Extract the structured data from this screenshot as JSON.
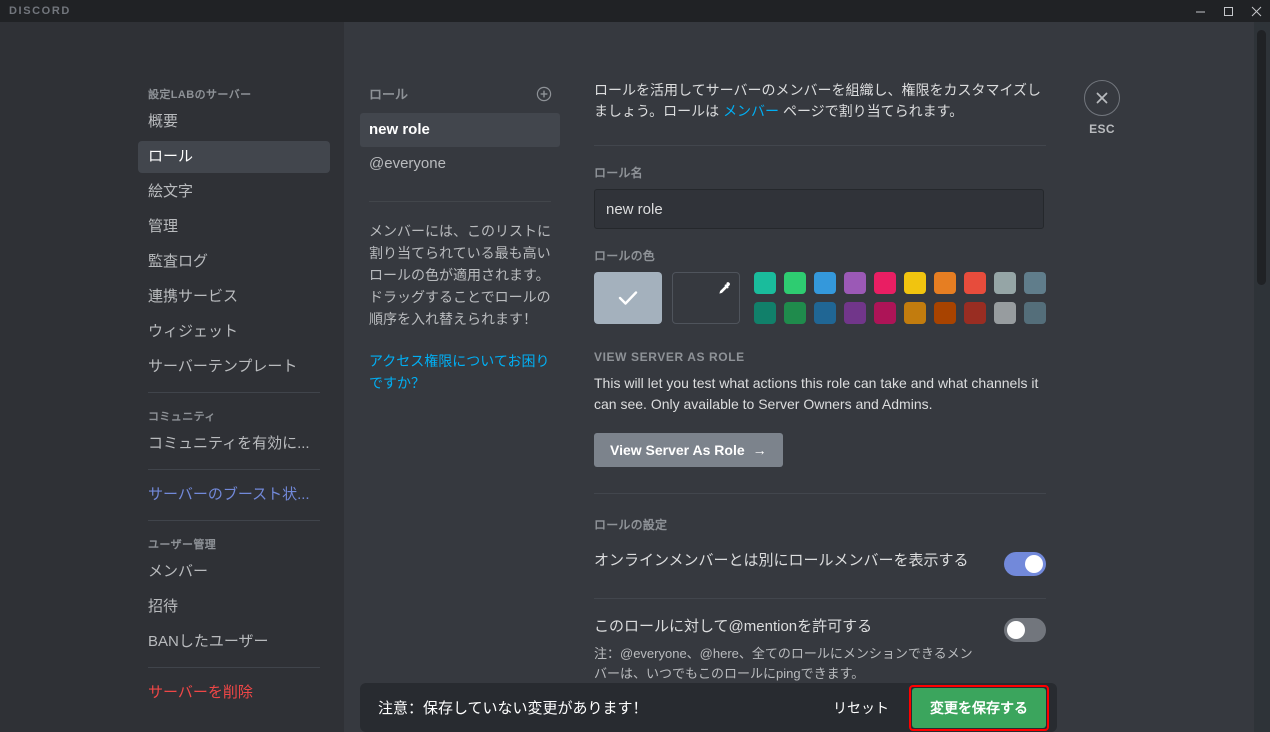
{
  "titlebar": {
    "brand": "DISCORD",
    "minimize_label": "minimize",
    "maximize_label": "maximize",
    "close_label": "close"
  },
  "sidebar": {
    "server_header": "設定LABのサーバー",
    "items": [
      {
        "label": "概要",
        "state": "normal"
      },
      {
        "label": "ロール",
        "state": "active"
      },
      {
        "label": "絵文字",
        "state": "normal"
      },
      {
        "label": "管理",
        "state": "normal"
      },
      {
        "label": "監査ログ",
        "state": "normal"
      },
      {
        "label": "連携サービス",
        "state": "normal"
      },
      {
        "label": "ウィジェット",
        "state": "normal"
      },
      {
        "label": "サーバーテンプレート",
        "state": "normal"
      }
    ],
    "community_header": "コミュニティ",
    "community_item": "コミュニティを有効に...",
    "boost_item": "サーバーのブースト状...",
    "user_header": "ユーザー管理",
    "user_items": [
      {
        "label": "メンバー"
      },
      {
        "label": "招待"
      },
      {
        "label": "BANしたユーザー"
      }
    ],
    "delete_item": "サーバーを削除"
  },
  "roles_panel": {
    "header": "ロール",
    "add_icon": "plus-circle-icon",
    "roles": [
      {
        "name": "new role",
        "selected": true
      },
      {
        "name": "@everyone",
        "selected": false
      }
    ],
    "note": "メンバーには、このリストに割り当てられている最も高いロールの色が適用されます。ドラッグすることでロールの順序を入れ替えられます！",
    "help_link": "アクセス権限についてお困りですか？"
  },
  "main": {
    "intro_before": "ロールを活用してサーバーのメンバーを組織し、権限をカスタマイズしましょう。ロールは ",
    "intro_link": "メンバー",
    "intro_after": " ページで割り当てられます。",
    "role_name_label": "ロール名",
    "role_name_value": "new role",
    "role_color_label": "ロールの色",
    "selected_color": "#a4b1bd",
    "check_icon": "check-icon",
    "dropper_icon": "eyedropper-icon",
    "palette": [
      "#1abc9c",
      "#2ecc71",
      "#3498db",
      "#9b59b6",
      "#e91e63",
      "#f1c40f",
      "#e67e22",
      "#e74c3c",
      "#95a5a6",
      "#607d8b",
      "#11806a",
      "#1f8b4c",
      "#206694",
      "#71368a",
      "#ad1457",
      "#c27c0e",
      "#a84300",
      "#992d22",
      "#979c9f",
      "#546e7a"
    ],
    "view_as_role_caps": "VIEW SERVER AS ROLE",
    "view_as_role_body": "This will let you test what actions this role can take and what channels it can see. Only available to Server Owners and Admins.",
    "view_as_role_button": "View Server As Role",
    "view_as_role_arrow": "→",
    "role_settings_label": "ロールの設定",
    "settings": [
      {
        "text": "オンラインメンバーとは別にロールメンバーを表示する",
        "sub": "",
        "enabled": true
      },
      {
        "text": "このロールに対して@mentionを許可する",
        "sub": "注：@everyone、@here、全てのロールにメンションできるメンバーは、いつでもこのロールにpingできます。",
        "enabled": false
      }
    ]
  },
  "esc": {
    "icon": "close-icon",
    "label": "ESC"
  },
  "savebar": {
    "message": "注意：保存していない変更があります！",
    "reset_label": "リセット",
    "save_label": "変更を保存する",
    "save_color": "#3ba55d",
    "highlight_color": "#ff0000"
  }
}
